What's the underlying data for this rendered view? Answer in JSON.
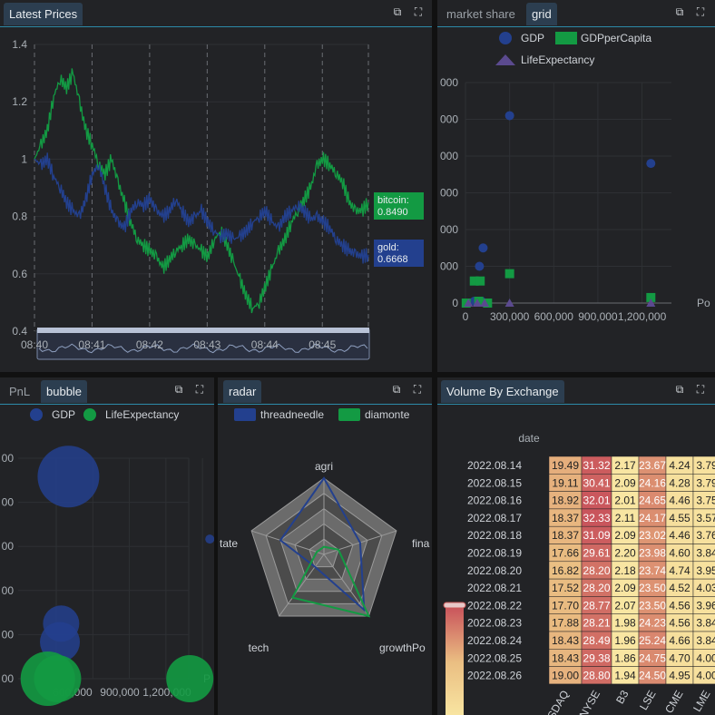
{
  "panels": {
    "prices": {
      "tab": "Latest Prices"
    },
    "grid": {
      "tabs": [
        "market share",
        "grid"
      ]
    },
    "bubble": {
      "tabs": [
        "PnL",
        "bubble"
      ]
    },
    "radar": {
      "tab": "radar"
    },
    "volume": {
      "tab": "Volume By Exchange"
    }
  },
  "icons": {
    "popout": "external-link-icon",
    "expand": "expand-icon"
  },
  "colors": {
    "bitcoin": "#139a43",
    "gold": "#23408e",
    "accent": "#2d8aa8",
    "life": "#5b4a8f"
  },
  "chart_data": [
    {
      "id": "prices",
      "type": "line",
      "ylim": [
        0.4,
        1.4
      ],
      "yticks": [
        "1.4",
        "1.2",
        "1",
        "0.8",
        "0.6",
        "0.4"
      ],
      "xticks": [
        "08:40",
        "08:41",
        "08:42",
        "08:43",
        "08:44",
        "08:45"
      ],
      "grid": true,
      "series": [
        {
          "name": "bitcoin",
          "values": [
            1.0,
            1.05,
            1.1,
            1.22,
            1.28,
            1.25,
            1.3,
            1.2,
            1.1,
            1.05,
            0.98,
            0.95,
            1.0,
            0.92,
            0.85,
            0.78,
            0.72,
            0.7,
            0.68,
            0.66,
            0.62,
            0.65,
            0.68,
            0.7,
            0.72,
            0.7,
            0.68,
            0.66,
            0.72,
            0.75,
            0.7,
            0.64,
            0.58,
            0.52,
            0.48,
            0.5,
            0.56,
            0.62,
            0.68,
            0.72,
            0.78,
            0.82,
            0.86,
            0.9,
            0.98,
            1.0,
            0.98,
            0.95,
            0.92,
            0.85,
            0.82,
            0.82,
            0.849
          ],
          "last_label": "0.8490"
        },
        {
          "name": "gold",
          "values": [
            1.0,
            0.98,
            1.0,
            0.94,
            0.9,
            0.85,
            0.82,
            0.8,
            0.86,
            0.95,
            0.98,
            0.9,
            0.82,
            0.78,
            0.76,
            0.82,
            0.85,
            0.84,
            0.86,
            0.82,
            0.8,
            0.82,
            0.86,
            0.82,
            0.78,
            0.8,
            0.82,
            0.78,
            0.75,
            0.73,
            0.74,
            0.72,
            0.73,
            0.75,
            0.78,
            0.8,
            0.82,
            0.78,
            0.76,
            0.8,
            0.82,
            0.84,
            0.82,
            0.79,
            0.8,
            0.78,
            0.76,
            0.72,
            0.7,
            0.68,
            0.67,
            0.66,
            0.6668
          ],
          "last_label": "0.6668"
        }
      ]
    },
    {
      "id": "grid-scatter",
      "type": "scatter",
      "legend": [
        "GDP",
        "GDPperCapita",
        "LifeExpectancy"
      ],
      "xticks": [
        "0",
        "300,000",
        "600,000",
        "900,000",
        "1,200,000"
      ],
      "xaxis_label": "Po",
      "yticks": [
        "0",
        "000",
        "000",
        "000",
        "000",
        "000",
        "000"
      ],
      "series": [
        {
          "name": "GDP",
          "points": [
            [
              80000,
              0.6
            ],
            [
              95000,
              1.0
            ],
            [
              120000,
              1.5
            ],
            [
              300000,
              5.1
            ],
            [
              1260000,
              3.8
            ],
            [
              60000,
              0.05
            ],
            [
              110000,
              0.05
            ]
          ]
        },
        {
          "name": "GDPperCapita",
          "points": [
            [
              5000,
              0.0
            ],
            [
              60000,
              0.6
            ],
            [
              100000,
              0.6
            ],
            [
              300000,
              0.8
            ],
            [
              1260000,
              0.15
            ],
            [
              150000,
              0.0
            ],
            [
              90000,
              0.05
            ]
          ]
        },
        {
          "name": "LifeExpectancy",
          "points": [
            [
              20000,
              0.0
            ],
            [
              80000,
              0.0
            ],
            [
              130000,
              0.0
            ],
            [
              300000,
              0.0
            ],
            [
              1260000,
              0.0
            ]
          ]
        }
      ]
    },
    {
      "id": "bubble",
      "type": "scatter",
      "legend": [
        "GDP",
        "LifeExpectancy"
      ],
      "xticks": [
        "600,000",
        "900,000",
        "1,200,000"
      ],
      "xaxis_label": "P",
      "yticks": [
        "00",
        "00",
        "00",
        "00",
        "00",
        "00"
      ],
      "series": [
        {
          "name": "GDP",
          "points": [
            [
              100000,
              5.5,
              34
            ],
            [
              1260000,
              3.8,
              5
            ],
            [
              40000,
              1.5,
              20
            ],
            [
              30000,
              1.0,
              22
            ]
          ]
        },
        {
          "name": "LifeExpectancy",
          "points": [
            [
              20000,
              0.0,
              30
            ],
            [
              100000,
              0.0,
              26
            ],
            [
              1260000,
              0.0,
              26
            ]
          ]
        }
      ]
    },
    {
      "id": "radar",
      "type": "radar",
      "legend": [
        "threadneedle",
        "diamonte"
      ],
      "indicators": [
        "agri",
        "fina",
        "growthPo",
        "tech",
        "tate"
      ],
      "series": [
        {
          "name": "threadneedle",
          "values": [
            1.0,
            0.5,
            0.9,
            0.2,
            0.6
          ]
        },
        {
          "name": "diamonte",
          "values": [
            0.1,
            0.2,
            1.0,
            0.7,
            0.1
          ]
        }
      ]
    },
    {
      "id": "volume-heatmap",
      "type": "heatmap",
      "title": "date",
      "rows": [
        "2022.08.14",
        "2022.08.15",
        "2022.08.16",
        "2022.08.17",
        "2022.08.18",
        "2022.08.19",
        "2022.08.20",
        "2022.08.21",
        "2022.08.22",
        "2022.08.23",
        "2022.08.24",
        "2022.08.25",
        "2022.08.26"
      ],
      "columns": [
        "ASDAQ",
        "NYSE",
        "B3",
        "LSE",
        "CME",
        "LME"
      ],
      "values": [
        [
          "19.49",
          "31.32",
          "2.17",
          "23.67",
          "4.24",
          "3.79"
        ],
        [
          "19.11",
          "30.41",
          "2.09",
          "24.16",
          "4.28",
          "3.79"
        ],
        [
          "18.92",
          "32.01",
          "2.01",
          "24.65",
          "4.46",
          "3.75"
        ],
        [
          "18.37",
          "32.33",
          "2.11",
          "24.17",
          "4.55",
          "3.57"
        ],
        [
          "18.37",
          "31.09",
          "2.09",
          "23.02",
          "4.46",
          "3.76"
        ],
        [
          "17.66",
          "29.61",
          "2.20",
          "23.98",
          "4.60",
          "3.84"
        ],
        [
          "16.82",
          "28.20",
          "2.18",
          "23.74",
          "4.74",
          "3.95"
        ],
        [
          "17.52",
          "28.20",
          "2.09",
          "23.50",
          "4.52",
          "4.03"
        ],
        [
          "17.70",
          "28.77",
          "2.07",
          "23.50",
          "4.56",
          "3.96"
        ],
        [
          "17.88",
          "28.21",
          "1.98",
          "24.23",
          "4.56",
          "3.84"
        ],
        [
          "18.43",
          "28.49",
          "1.96",
          "25.24",
          "4.66",
          "3.84"
        ],
        [
          "18.43",
          "29.38",
          "1.86",
          "24.75",
          "4.70",
          "4.00"
        ],
        [
          "19.00",
          "28.80",
          "1.94",
          "24.50",
          "4.95",
          "4.00"
        ]
      ],
      "range": [
        1.5,
        33
      ]
    }
  ]
}
